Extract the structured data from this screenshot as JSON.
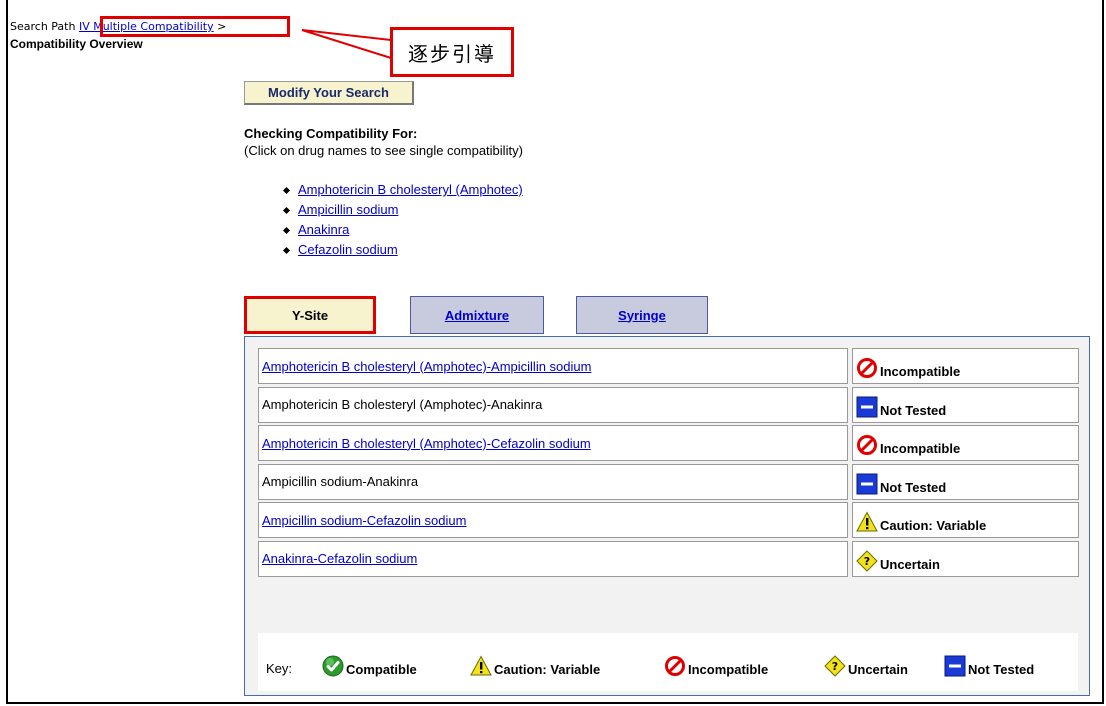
{
  "search_path": {
    "label": "Search Path",
    "link": "IV Multiple Compatibility",
    "separator": ">"
  },
  "page_title": "Compatibility Overview",
  "annotation": {
    "text": "逐步引導",
    "color": "#e00000"
  },
  "modify_button": "Modify Your Search",
  "checking": {
    "title": "Checking Compatibility For:",
    "note": "(Click on drug names to see single compatibility)",
    "drugs": [
      "Amphotericin B cholesteryl (Amphotec)",
      "Ampicillin sodium",
      "Anakinra",
      "Cefazolin sodium"
    ]
  },
  "tabs": [
    {
      "label": "Y-Site",
      "active": true
    },
    {
      "label": "Admixture",
      "active": false
    },
    {
      "label": "Syringe",
      "active": false
    }
  ],
  "results": [
    {
      "pair": "Amphotericin B cholesteryl (Amphotec)-Ampicillin sodium",
      "link": true,
      "status": "Incompatible",
      "icon": "incompatible-icon"
    },
    {
      "pair": "Amphotericin B cholesteryl (Amphotec)-Anakinra",
      "link": false,
      "status": "Not Tested",
      "icon": "not-tested-icon"
    },
    {
      "pair": "Amphotericin B cholesteryl (Amphotec)-Cefazolin sodium",
      "link": true,
      "status": "Incompatible",
      "icon": "incompatible-icon"
    },
    {
      "pair": "Ampicillin sodium-Anakinra",
      "link": false,
      "status": "Not Tested",
      "icon": "not-tested-icon"
    },
    {
      "pair": "Ampicillin sodium-Cefazolin sodium",
      "link": true,
      "status": "Caution: Variable",
      "icon": "caution-icon"
    },
    {
      "pair": "Anakinra-Cefazolin sodium",
      "link": true,
      "status": "Uncertain",
      "icon": "uncertain-icon"
    }
  ],
  "key": {
    "label": "Key:",
    "items": [
      {
        "label": "Compatible",
        "icon": "compatible-icon"
      },
      {
        "label": "Caution: Variable",
        "icon": "caution-icon"
      },
      {
        "label": "Incompatible",
        "icon": "incompatible-icon"
      },
      {
        "label": "Uncertain",
        "icon": "uncertain-icon"
      },
      {
        "label": "Not Tested",
        "icon": "not-tested-icon"
      }
    ]
  },
  "colors": {
    "link": "#0000cc",
    "tab_active_bg": "#f7f3cf",
    "tab_inactive_bg": "#c8cbde",
    "highlight": "#e00000"
  }
}
